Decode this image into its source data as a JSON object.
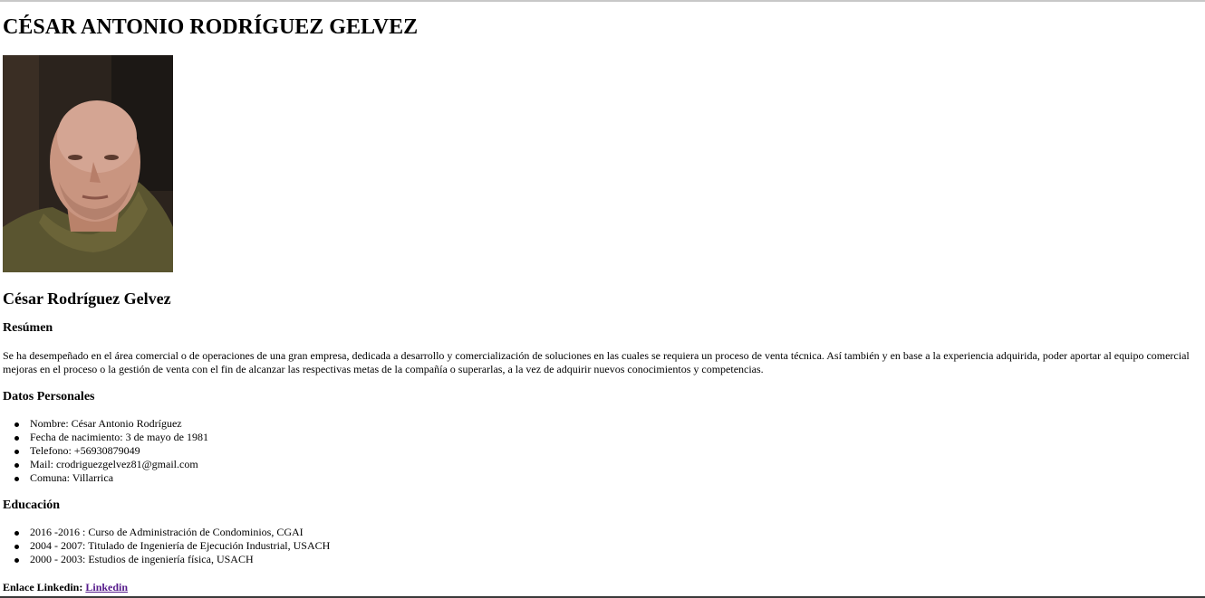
{
  "header": {
    "title": "CÉSAR ANTONIO RODRÍGUEZ GELVEZ"
  },
  "profile": {
    "name": "César Rodríguez Gelvez"
  },
  "resumen": {
    "heading": "Resúmen",
    "text": "Se ha desempeñado en el área comercial o de operaciones de una gran empresa, dedicada a desarrollo y comercialización de soluciones en las cuales se requiera un proceso de venta técnica. Así también y en base a la experiencia adquirida, poder aportar al equipo comercial mejoras en el proceso o la gestión de venta con el fin de alcanzar las respectivas metas de la compañía o superarlas, a la vez de adquirir nuevos conocimientos y competencias."
  },
  "datos": {
    "heading": "Datos Personales",
    "items": [
      "Nombre: César Antonio Rodríguez",
      "Fecha de nacimiento: 3 de mayo de 1981",
      "Telefono: +56930879049",
      "Mail: crodriguezgelvez81@gmail.com",
      "Comuna: Villarrica"
    ]
  },
  "educacion": {
    "heading": "Educación",
    "items": [
      "2016 -2016 : Curso de Administración de Condominios, CGAI",
      "2004 - 2007: Titulado de Ingeniería de Ejecución Industrial, USACH",
      "2000 - 2003: Estudios de ingeniería física, USACH"
    ]
  },
  "linkedin": {
    "label": "Enlace Linkedin:",
    "link_text": "Linkedin"
  },
  "colors": {
    "link": "#551a8b",
    "text": "#000000",
    "background": "#ffffff"
  }
}
